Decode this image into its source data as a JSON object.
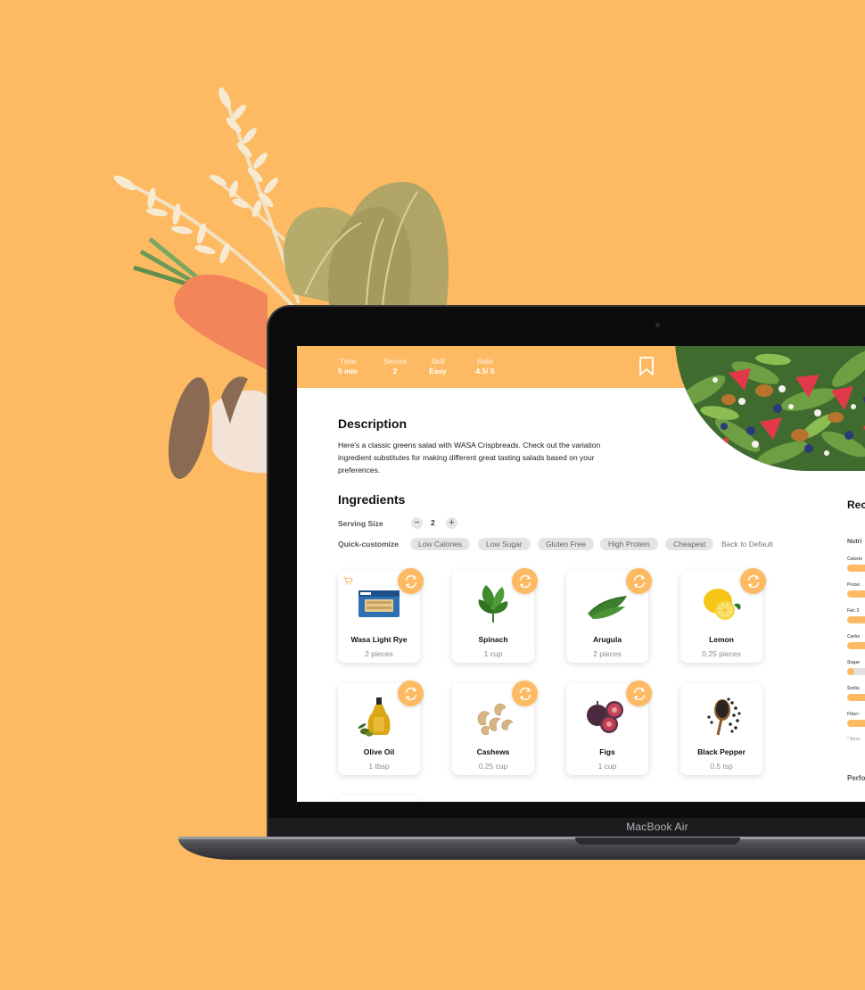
{
  "header": {
    "stats": [
      {
        "label": "Time",
        "value": "5 min"
      },
      {
        "label": "Serves",
        "value": "2"
      },
      {
        "label": "Skill",
        "value": "Easy"
      },
      {
        "label": "Rate",
        "value": "4.5/ 5"
      }
    ]
  },
  "description": {
    "title": "Description",
    "text": "Here's a classic greens salad with WASA Crispbreads. Check out the variation ingredient substitutes for making different great tasting salads based on your preferences."
  },
  "ingredients": {
    "title": "Ingredients",
    "serving_label": "Serving Size",
    "serving_value": "2",
    "minus": "−",
    "plus": "+",
    "customize_label": "Quick-customize",
    "filters": [
      "Low Calories",
      "Low Sugar",
      "Gluten Free",
      "High Protein",
      "Cheapest"
    ],
    "back_default": "Back to Default",
    "items": [
      {
        "name": "Wasa Light Rye",
        "amount": "2 pieces",
        "icon": "crispbread-image"
      },
      {
        "name": "Spinach",
        "amount": "1 cup",
        "icon": "spinach-image"
      },
      {
        "name": "Arugula",
        "amount": "2 pieces",
        "icon": "arugula-image"
      },
      {
        "name": "Lemon",
        "amount": "0.25 pieces",
        "icon": "lemon-image"
      },
      {
        "name": "Olive Oil",
        "amount": "1 tbsp",
        "icon": "olive-oil-image"
      },
      {
        "name": "Cashews",
        "amount": "0.25 cup",
        "icon": "cashews-image"
      },
      {
        "name": "Figs",
        "amount": "1 cup",
        "icon": "figs-image"
      },
      {
        "name": "Black Pepper",
        "amount": "0.5 tsp",
        "icon": "black-pepper-image"
      }
    ]
  },
  "sidebar": {
    "title": "Rec",
    "nutrition_title": "Nutri",
    "nutrients": [
      "Calorie",
      "Protei",
      "Fat: 3",
      "Carbs",
      "Sugar",
      "Sodiu",
      "Fiber:"
    ],
    "note": "* Base",
    "perf": "Perfo"
  },
  "laptop": {
    "model": "MacBook Air"
  },
  "colors": {
    "accent": "#FDBA63",
    "background": "#FDBA63"
  }
}
